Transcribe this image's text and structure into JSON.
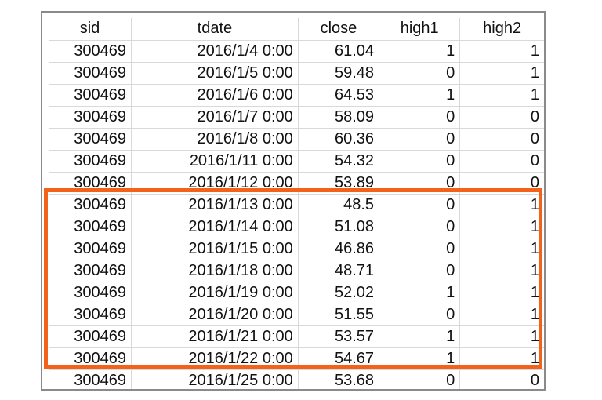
{
  "columns": [
    "sid",
    "tdate",
    "close",
    "high1",
    "high2"
  ],
  "rows": [
    [
      "300469",
      "2016/1/4 0:00",
      "61.04",
      "1",
      "1"
    ],
    [
      "300469",
      "2016/1/5 0:00",
      "59.48",
      "0",
      "1"
    ],
    [
      "300469",
      "2016/1/6 0:00",
      "64.53",
      "1",
      "1"
    ],
    [
      "300469",
      "2016/1/7 0:00",
      "58.09",
      "0",
      "0"
    ],
    [
      "300469",
      "2016/1/8 0:00",
      "60.36",
      "0",
      "0"
    ],
    [
      "300469",
      "2016/1/11 0:00",
      "54.32",
      "0",
      "0"
    ],
    [
      "300469",
      "2016/1/12 0:00",
      "53.89",
      "0",
      "0"
    ],
    [
      "300469",
      "2016/1/13 0:00",
      "48.5",
      "0",
      "1"
    ],
    [
      "300469",
      "2016/1/14 0:00",
      "51.08",
      "0",
      "1"
    ],
    [
      "300469",
      "2016/1/15 0:00",
      "46.86",
      "0",
      "1"
    ],
    [
      "300469",
      "2016/1/18 0:00",
      "48.71",
      "0",
      "1"
    ],
    [
      "300469",
      "2016/1/19 0:00",
      "52.02",
      "1",
      "1"
    ],
    [
      "300469",
      "2016/1/20 0:00",
      "51.55",
      "0",
      "1"
    ],
    [
      "300469",
      "2016/1/21 0:00",
      "53.57",
      "1",
      "1"
    ],
    [
      "300469",
      "2016/1/22 0:00",
      "54.67",
      "1",
      "1"
    ],
    [
      "300469",
      "2016/1/25 0:00",
      "53.68",
      "0",
      "0"
    ]
  ],
  "highlight": {
    "first_row": 8,
    "last_row": 15,
    "color": "#f4621a"
  }
}
